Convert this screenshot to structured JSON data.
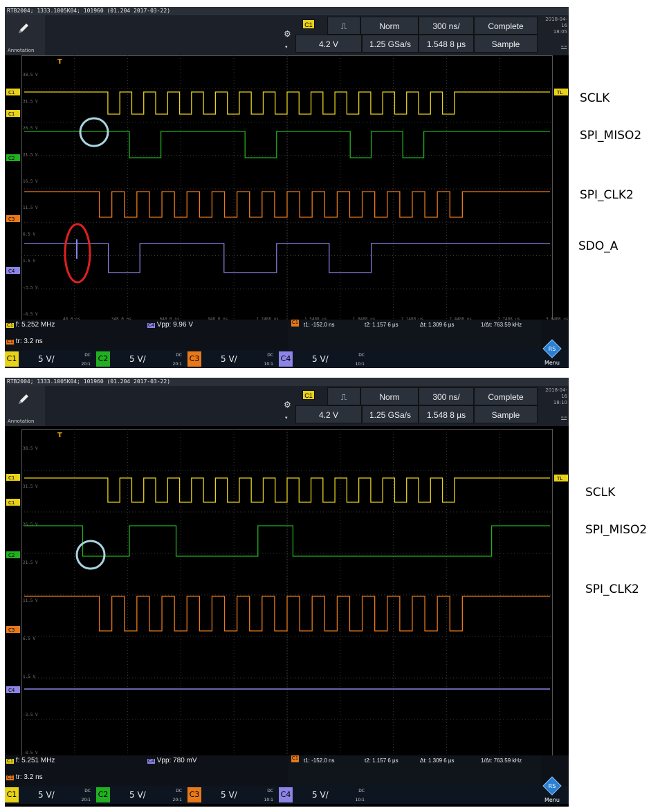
{
  "screens": [
    {
      "title": "RTB2004; 1333.1005K04; 101960 (01.204 2017-03-22)",
      "annotation_label": "Annotation",
      "trigger": {
        "channel": "C1",
        "type_icon": "edge-pulse-icon",
        "mode": "Norm",
        "timebase": "300 ns/",
        "acq": "Complete",
        "level": "4.2 V",
        "rate": "1.25 GSa/s",
        "position": "1.548 8 µs",
        "acq_mode": "Sample"
      },
      "date": "2018-04-16",
      "time": "18:05",
      "measurements": {
        "m1_label": "C1",
        "m1": "f: 5.252 MHz",
        "m2_label": "C4",
        "m2": "Vpp: 9.96 V",
        "m3_label": "C1",
        "m3": "tr: 3.2 ns",
        "cursor_label": "C1",
        "t1": "t1: -152.0 ns",
        "t2": "t2: 1.157 6 µs",
        "dt": "Δt: 1.309 6 µs",
        "inv_dt": "1/Δt: 763.59 kHz"
      },
      "channels": [
        {
          "label": "C1",
          "scale": "5 V/",
          "coupling": "DC",
          "ratio": "20:1",
          "color": "#e8d21a"
        },
        {
          "label": "C2",
          "scale": "5 V/",
          "coupling": "DC",
          "ratio": "20:1",
          "color": "#21b021"
        },
        {
          "label": "C3",
          "scale": "5 V/",
          "coupling": "DC",
          "ratio": "10:1",
          "color": "#e8791a"
        },
        {
          "label": "C4",
          "scale": "5 V/",
          "coupling": "DC",
          "ratio": "10:1",
          "color": "#8c84e6"
        }
      ],
      "trace_markers": [
        "C1",
        "C1",
        "C2",
        "C3",
        "C4"
      ],
      "trigger_level_tag": "TL",
      "menu_label": "Menu",
      "signals": [
        "SCLK",
        "SPI_MISO2",
        "SPI_CLK2",
        "SDO_A"
      ],
      "time_ticks": [
        "48.0 ns",
        "348.0 ns",
        "648.0 ns",
        "948.0 ns",
        "1.2488 µs",
        "1.5488 µs",
        "1.8488 µs",
        "2.1488 µs",
        "2.4488 µs",
        "2.7488 µs",
        "3.0488 µs"
      ],
      "volt_ticks": [
        "38.5 V",
        "31.5 V",
        "26.5 V",
        "21.5 V",
        "16.5 V",
        "11.5 V",
        "6.5 V",
        "1.5 V",
        "-3.5 V",
        "-8.5 V"
      ],
      "highlights": {
        "blue_circle": "miso-edge",
        "red_circle": "sdo-glitch"
      }
    },
    {
      "title": "RTB2004; 1333.1005K04; 101960 (01.204 2017-03-22)",
      "annotation_label": "Annotation",
      "trigger": {
        "channel": "C1",
        "type_icon": "edge-pulse-icon",
        "mode": "Norm",
        "timebase": "300 ns/",
        "acq": "Complete",
        "level": "4.2 V",
        "rate": "1.25 GSa/s",
        "position": "1.548 8 µs",
        "acq_mode": "Sample"
      },
      "date": "2018-04-16",
      "time": "18:10",
      "measurements": {
        "m1_label": "C1",
        "m1": "f: 5.251 MHz",
        "m2_label": "C4",
        "m2": "Vpp: 780 mV",
        "m3_label": "C1",
        "m3": "tr: 3.2 ns",
        "cursor_label": "C1",
        "t1": "t1: -152.0 ns",
        "t2": "t2: 1.157 6 µs",
        "dt": "Δt: 1.309 6 µs",
        "inv_dt": "1/Δt: 763.59 kHz"
      },
      "channels": [
        {
          "label": "C1",
          "scale": "5 V/",
          "coupling": "DC",
          "ratio": "20:1",
          "color": "#e8d21a"
        },
        {
          "label": "C2",
          "scale": "5 V/",
          "coupling": "DC",
          "ratio": "20:1",
          "color": "#21b021"
        },
        {
          "label": "C3",
          "scale": "5 V/",
          "coupling": "DC",
          "ratio": "10:1",
          "color": "#e8791a"
        },
        {
          "label": "C4",
          "scale": "5 V/",
          "coupling": "DC",
          "ratio": "10:1",
          "color": "#8c84e6"
        }
      ],
      "trace_markers": [
        "C1",
        "C1",
        "C2",
        "C3",
        "C4"
      ],
      "trigger_level_tag": "TL",
      "menu_label": "Menu",
      "signals": [
        "SCLK",
        "SPI_MISO2",
        "SPI_CLK2"
      ],
      "time_ticks": [
        "48.0 ns",
        "348.0 ns",
        "648.0 ns",
        "948.0 ns",
        "1.2488 µs",
        "1.5488 µs",
        "1.8488 µs",
        "2.1488 µs",
        "2.4488 µs",
        "2.7488 µs",
        "3.0488 µs"
      ],
      "volt_ticks": [
        "38.5 V",
        "31.5 V",
        "26.5 V",
        "21.5 V",
        "11.5 V",
        "6.5 V",
        "1.5 V",
        "-3.5 V",
        "-8.5 V"
      ],
      "highlights": {
        "blue_circle": "miso-edge"
      }
    }
  ],
  "colors": {
    "sclk": "#e8d21a",
    "miso": "#21b021",
    "clk2": "#e8791a",
    "sdo": "#8c84e6",
    "blue_circle": "#a8d4e0",
    "red_circle": "#e02020"
  }
}
